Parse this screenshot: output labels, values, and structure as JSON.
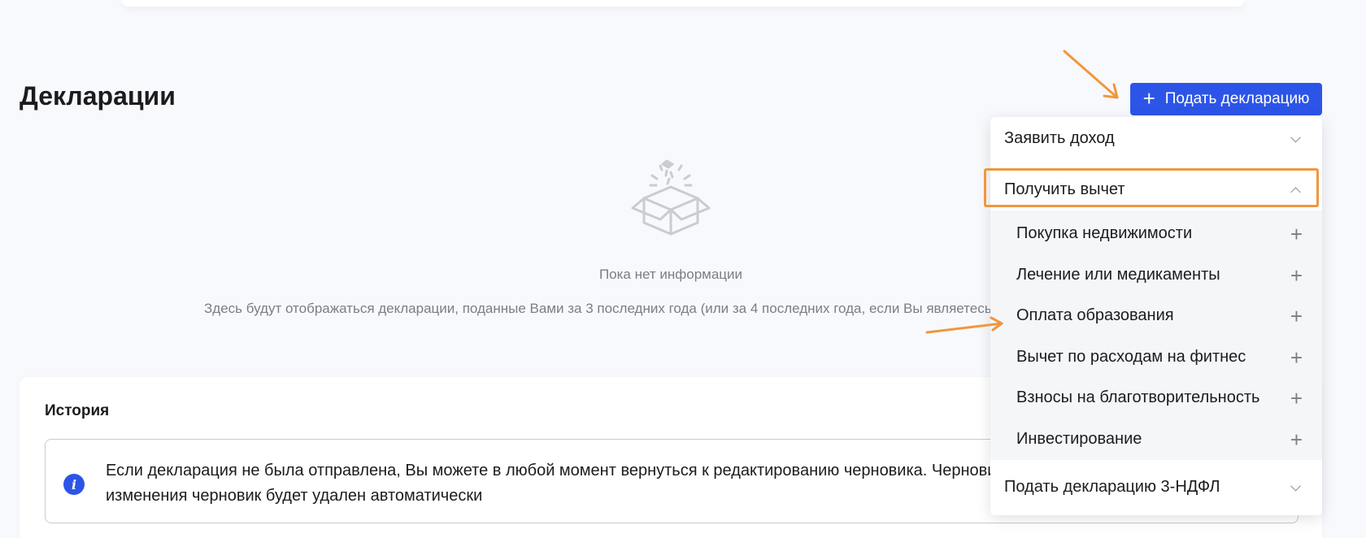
{
  "page": {
    "title": "Декларации",
    "submit_button": {
      "icon": "plus-icon",
      "label": "Подать декларацию"
    }
  },
  "empty_state": {
    "icon": "open-box-icon",
    "title": "Пока нет информации",
    "description": "Здесь будут отображаться декларации, поданные Вами за 3 последних года (или за 4 последних года, если Вы являетесь"
  },
  "history": {
    "title": "История",
    "info": {
      "icon": "info-icon",
      "line1": "Если декларация не была отправлена, Вы можете в любой момент вернуться к редактированию черновика. Черновик",
      "line2": "изменения черновик будет удален автоматически"
    }
  },
  "dropdown": {
    "sections": [
      {
        "label": "Заявить доход",
        "state": "collapsed"
      },
      {
        "label": "Получить вычет",
        "state": "expanded"
      },
      {
        "label": "Подать декларацию 3-НДФЛ",
        "state": "collapsed"
      }
    ],
    "deduction_items": [
      {
        "label": "Покупка недвижимости",
        "icon": "plus-icon"
      },
      {
        "label": "Лечение или медикаменты",
        "icon": "plus-icon"
      },
      {
        "label": "Оплата образования",
        "icon": "plus-icon"
      },
      {
        "label": "Вычет по расходам на фитнес",
        "icon": "plus-icon"
      },
      {
        "label": "Взносы на благотворительность",
        "icon": "plus-icon"
      },
      {
        "label": "Инвестирование",
        "icon": "plus-icon"
      }
    ]
  },
  "colors": {
    "accent": "#2c55e8",
    "annotation": "#f0973d",
    "background": "#f8f9fc",
    "muted_text": "#7a7e87"
  }
}
